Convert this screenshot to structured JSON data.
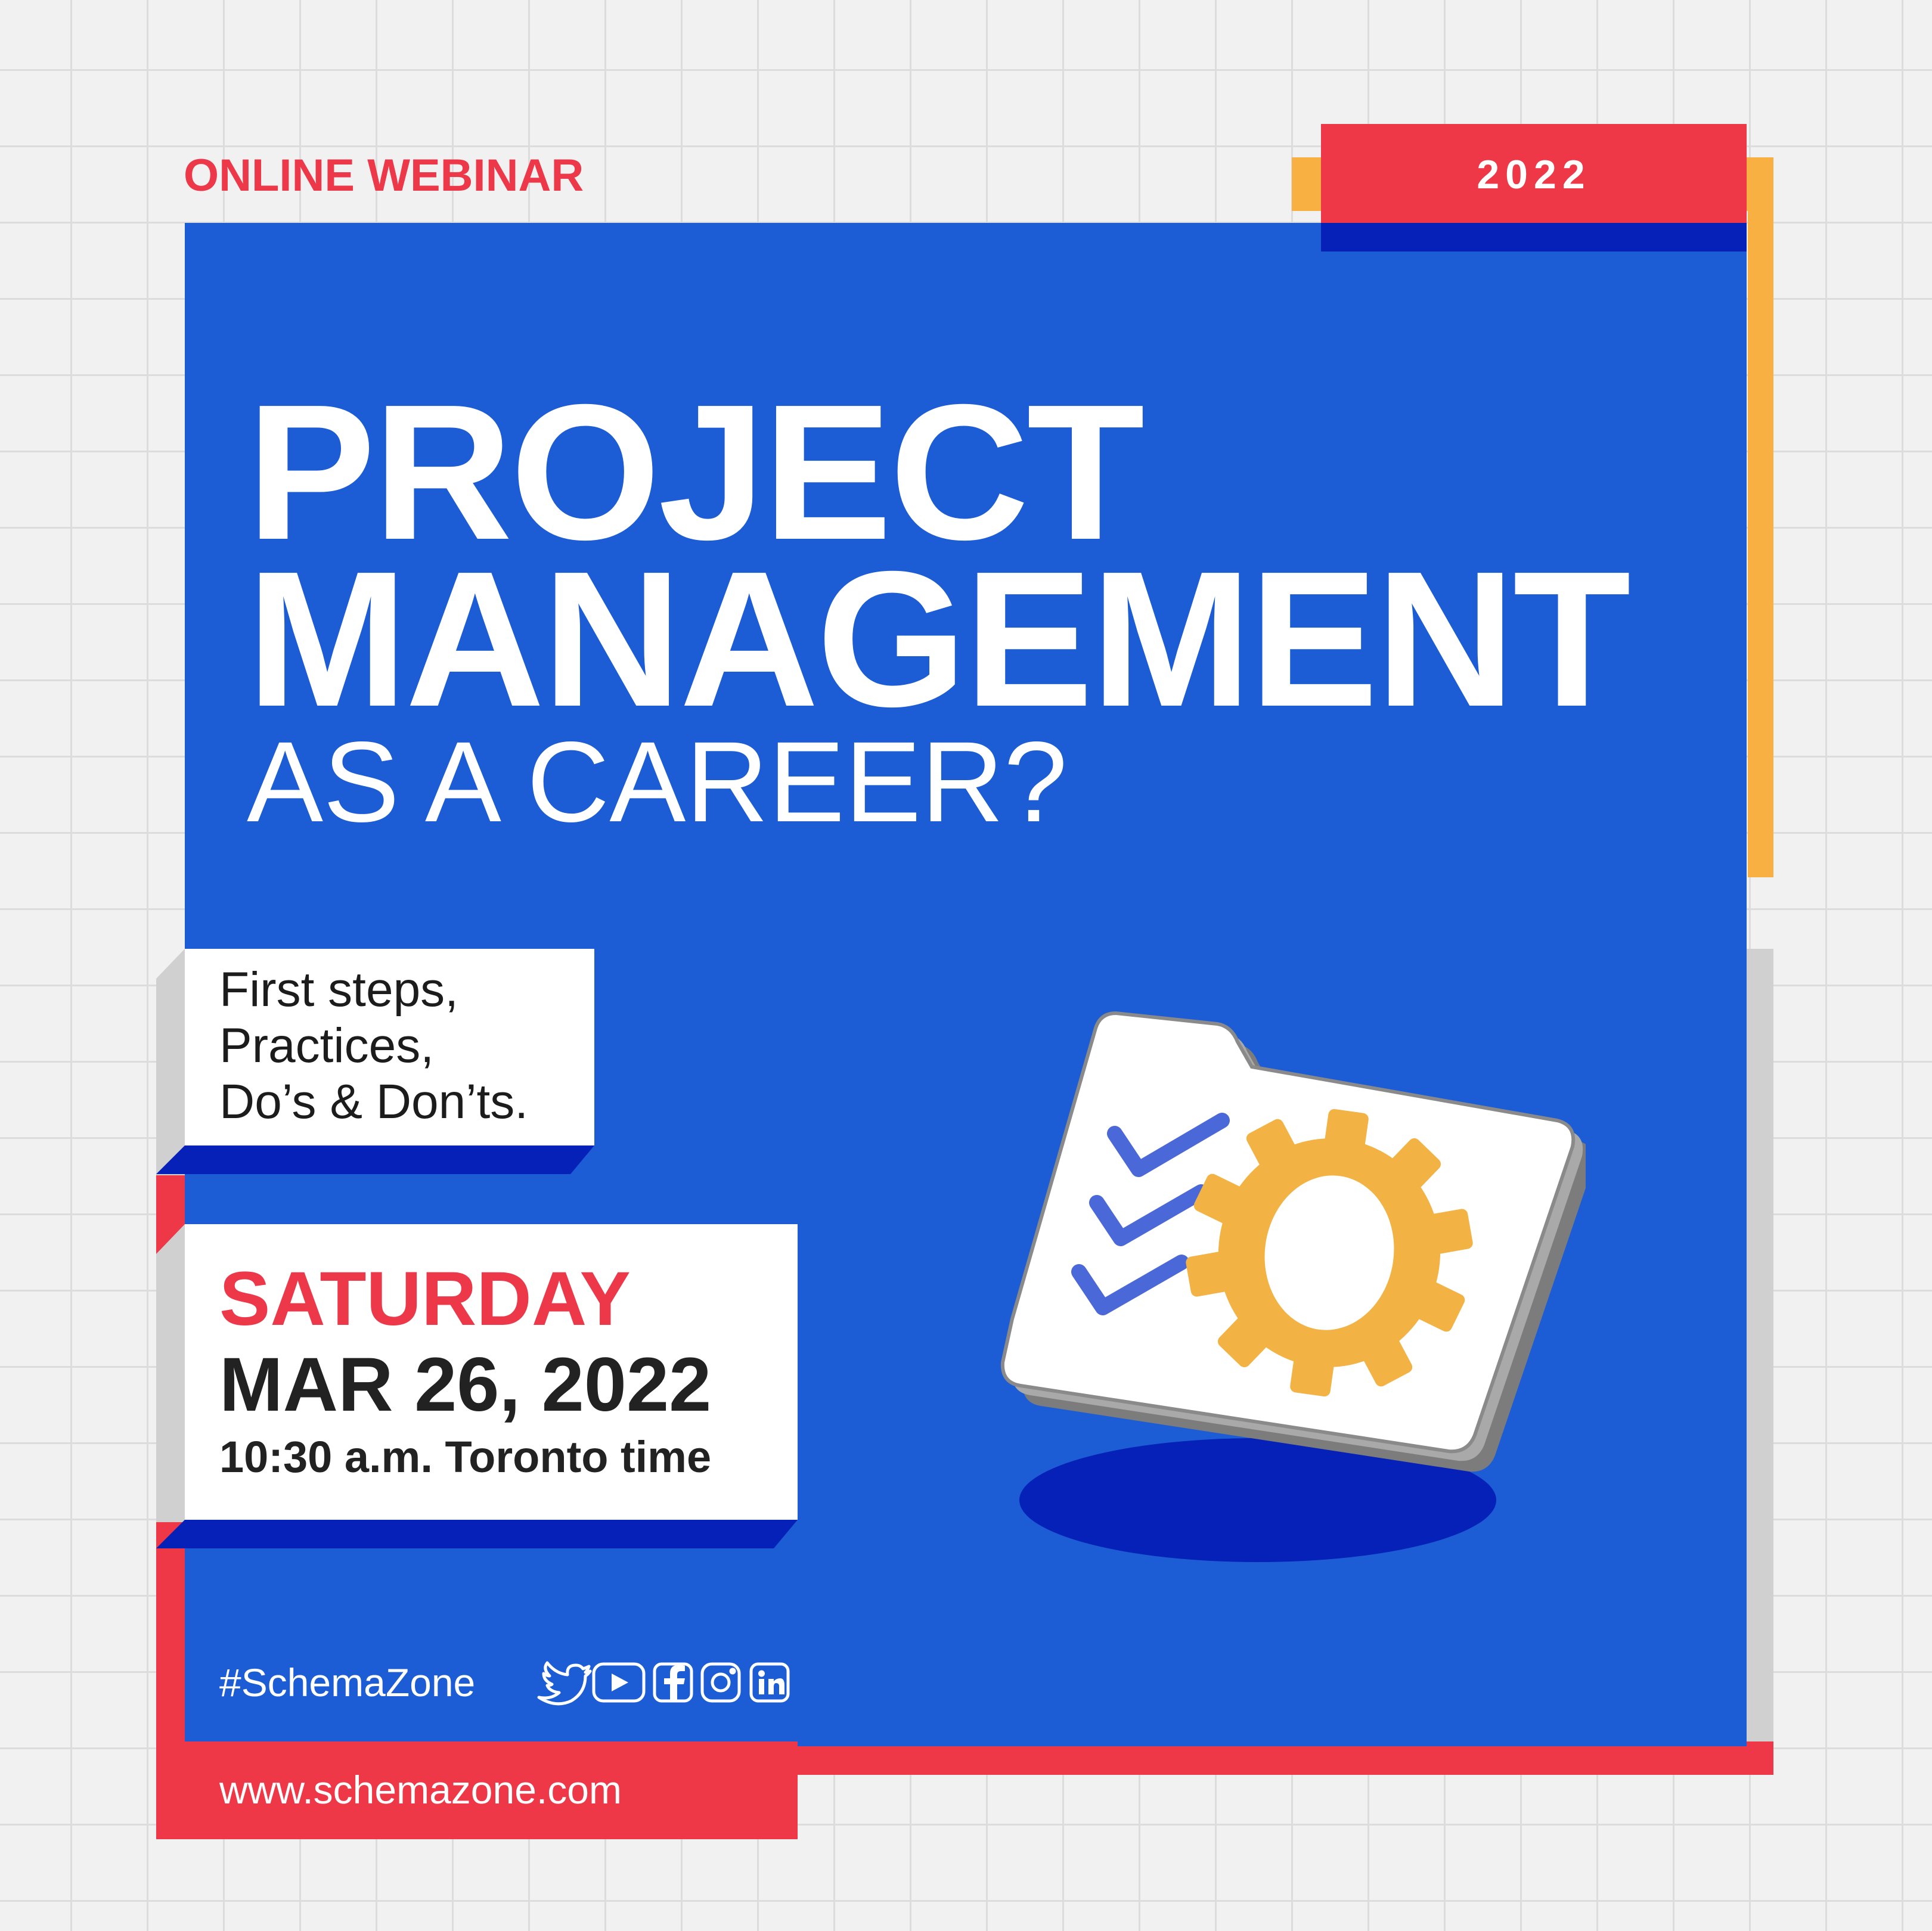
{
  "header": {
    "eyebrow": "ONLINE WEBINAR",
    "year": "2022"
  },
  "title": {
    "line1": "PROJECT",
    "line2": "MANAGEMENT",
    "subtitle": "AS A CAREER?"
  },
  "topics": {
    "line1": "First steps,",
    "line2": "Practices,",
    "line3": "Do’s & Don’ts."
  },
  "event": {
    "day": "SATURDAY",
    "date": "MAR 26, 2022",
    "time": "10:30 a.m. Toronto time"
  },
  "footer": {
    "hashtag": "#SchemaZone",
    "website": "www.schemazone.com",
    "social_icons": [
      "twitter-icon",
      "youtube-icon",
      "facebook-icon",
      "instagram-icon",
      "linkedin-icon"
    ]
  },
  "colors": {
    "card_blue": "#1c5dd6",
    "accent_red": "#ee3847",
    "accent_orange": "#f9b043",
    "navy": "#0521b7",
    "gear": "#f2b344",
    "check": "#4a68d8"
  }
}
